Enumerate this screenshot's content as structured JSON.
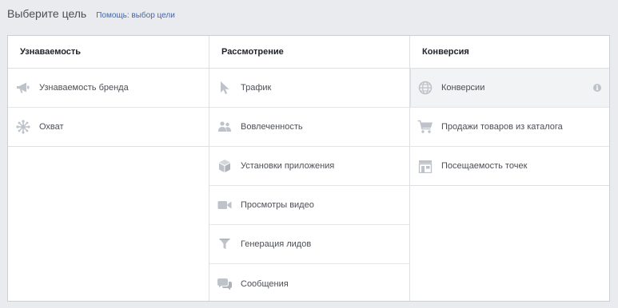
{
  "header": {
    "title": "Выберите цель",
    "help_link": "Помощь: выбор цели"
  },
  "columns": [
    {
      "title": "Узнаваемость",
      "items": [
        {
          "label": "Узнаваемость бренда",
          "icon": "megaphone-icon"
        },
        {
          "label": "Охват",
          "icon": "reach-icon"
        }
      ]
    },
    {
      "title": "Рассмотрение",
      "items": [
        {
          "label": "Трафик",
          "icon": "cursor-icon"
        },
        {
          "label": "Вовлеченность",
          "icon": "people-icon"
        },
        {
          "label": "Установки приложения",
          "icon": "box-icon"
        },
        {
          "label": "Просмотры видео",
          "icon": "video-camera-icon"
        },
        {
          "label": "Генерация лидов",
          "icon": "funnel-icon"
        },
        {
          "label": "Сообщения",
          "icon": "chat-bubbles-icon"
        }
      ]
    },
    {
      "title": "Конверсия",
      "items": [
        {
          "label": "Конверсии",
          "icon": "globe-icon",
          "selected": true,
          "info": "i"
        },
        {
          "label": "Продажи товаров из каталога",
          "icon": "cart-icon"
        },
        {
          "label": "Посещаемость точек",
          "icon": "store-icon"
        }
      ]
    }
  ],
  "colors": {
    "background": "#e9ebee",
    "panel": "#ffffff",
    "border": "#dddfe2",
    "icon": "#bec3c9",
    "link": "#4267b2",
    "selected_row": "#f2f3f5"
  }
}
